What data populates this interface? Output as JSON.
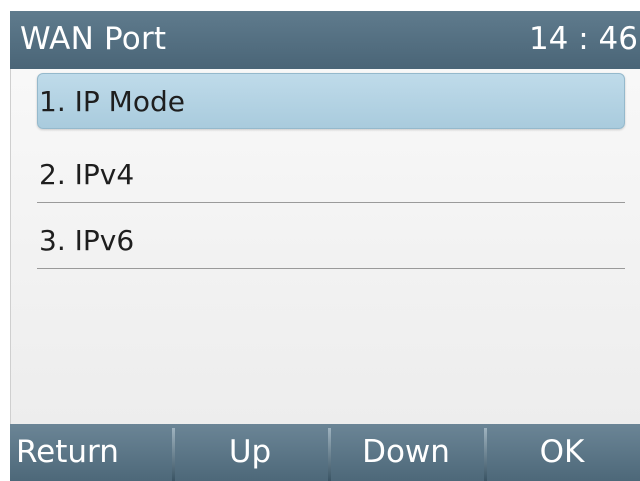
{
  "header": {
    "title": "WAN Port",
    "time": "14 : 46"
  },
  "menu": {
    "items": [
      {
        "label": "1. IP Mode",
        "selected": true
      },
      {
        "label": "2. IPv4",
        "selected": false
      },
      {
        "label": "3. IPv6",
        "selected": false
      }
    ]
  },
  "softkeys": {
    "return_label": "Return",
    "up_label": "Up",
    "down_label": "Down",
    "ok_label": "OK"
  },
  "colors": {
    "titlebar": "#4f6a7c",
    "selection": "#b3d2e3",
    "softkey_bar": "#5a7587"
  }
}
